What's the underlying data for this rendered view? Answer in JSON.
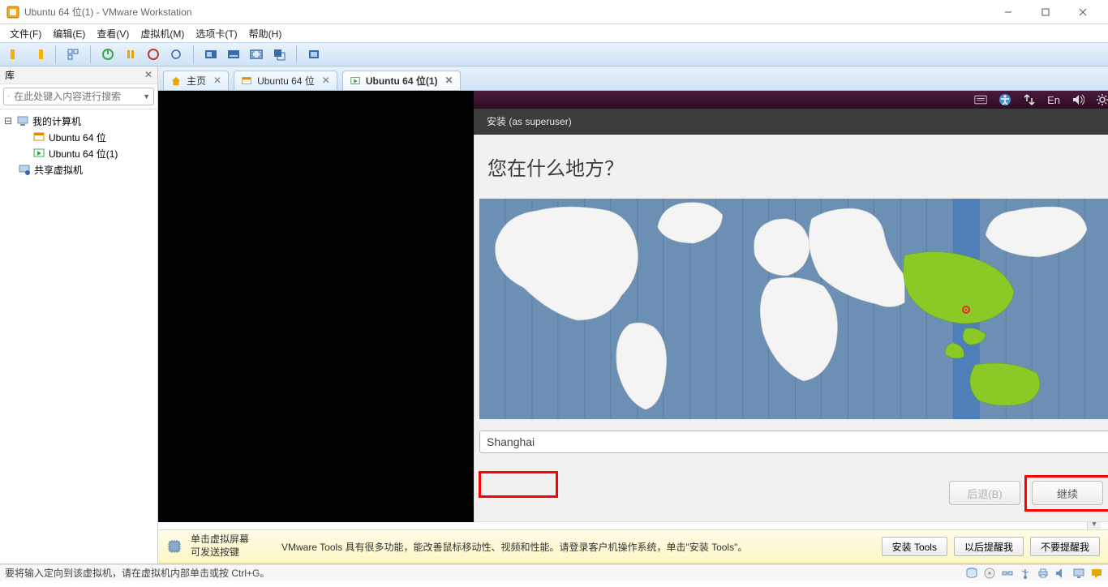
{
  "window": {
    "title": "Ubuntu 64 位(1) - VMware Workstation"
  },
  "menu": {
    "file": "文件(F)",
    "edit": "编辑(E)",
    "view": "查看(V)",
    "vm": "虚拟机(M)",
    "tabs": "选项卡(T)",
    "help": "帮助(H)"
  },
  "library": {
    "title": "库",
    "search_placeholder": "在此处键入内容进行搜索",
    "my_computer": "我的计算机",
    "vm1": "Ubuntu 64 位",
    "vm2": "Ubuntu 64 位(1)",
    "shared": "共享虚拟机"
  },
  "tabs": {
    "home": "主页",
    "t1": "Ubuntu 64 位",
    "t2": "Ubuntu 64 位(1)"
  },
  "guest": {
    "installer_title": "安装 (as superuser)",
    "question": "您在什么地方？",
    "timezone_value": "Shanghai",
    "lang_indicator": "En",
    "back": "后退(B)",
    "continue": "继续"
  },
  "hint": {
    "line1": "单击虚拟屏幕",
    "line2": "可发送按键",
    "message": "VMware Tools 具有很多功能，能改善鼠标移动性、视频和性能。请登录客户机操作系统，单击\"安装 Tools\"。",
    "install": "安装 Tools",
    "later": "以后提醒我",
    "never": "不要提醒我"
  },
  "status": {
    "text": "要将输入定向到该虚拟机，请在虚拟机内部单击或按 Ctrl+G。"
  }
}
